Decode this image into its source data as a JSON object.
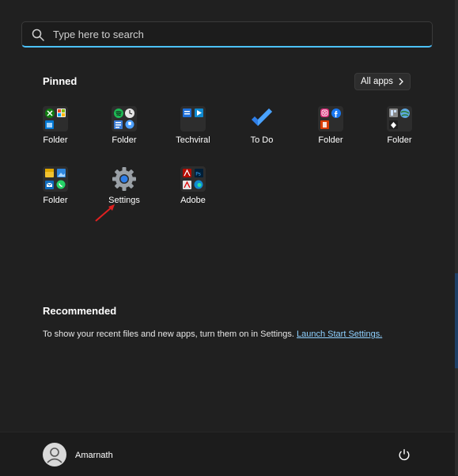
{
  "search": {
    "placeholder": "Type here to search"
  },
  "pinned": {
    "title": "Pinned",
    "all_apps_label": "All apps",
    "items": [
      {
        "label": "Folder",
        "icon": "xbox-folder-icon"
      },
      {
        "label": "Folder",
        "icon": "spotify-folder-icon"
      },
      {
        "label": "Techviral",
        "icon": "techviral-folder-icon"
      },
      {
        "label": "To Do",
        "icon": "todo-icon"
      },
      {
        "label": "Folder",
        "icon": "instagram-folder-icon"
      },
      {
        "label": "Folder",
        "icon": "misc-folder-icon"
      },
      {
        "label": "Folder",
        "icon": "photos-whatsapp-folder-icon"
      },
      {
        "label": "Settings",
        "icon": "gear-icon"
      },
      {
        "label": "Adobe",
        "icon": "adobe-folder-icon"
      }
    ]
  },
  "recommended": {
    "title": "Recommended",
    "text": "To show your recent files and new apps, turn them on in Settings.",
    "link": "Launch Start Settings."
  },
  "user": {
    "name": "Amarnath"
  },
  "colors": {
    "accent": "#4cc2ff",
    "background": "#202020",
    "annotation_arrow": "#e02020"
  }
}
